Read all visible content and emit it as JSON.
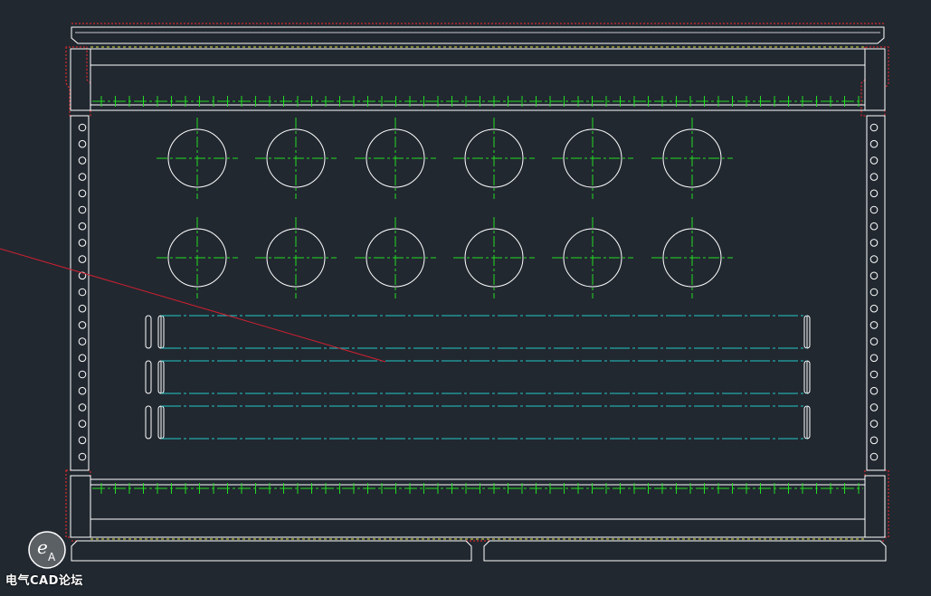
{
  "viewport": {
    "background": "#212830",
    "colors": {
      "outline": "#ffffff",
      "border_dashed": "#ff2a2a",
      "inner_dashed": "#e6e64a",
      "centerline": "#22dd22",
      "rail_centerline": "#22c8c8",
      "pointer_line": "#d02030"
    }
  },
  "watermark": {
    "logo_icon": "ea-circle-logo",
    "text": "电气CAD论坛"
  }
}
